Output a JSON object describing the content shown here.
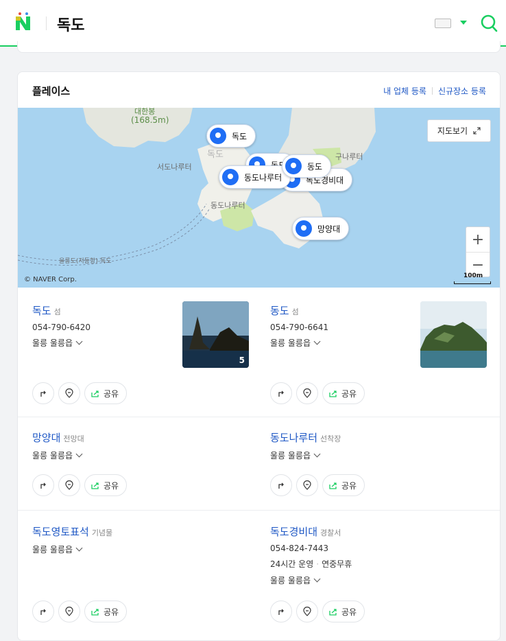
{
  "header": {
    "query": "독도",
    "icons": [
      "naver-logo-icon",
      "keyboard-icon",
      "caret-down-icon",
      "search-icon"
    ],
    "accent_color": "#19ce60"
  },
  "card": {
    "title": "플레이스",
    "links": [
      "내 업체 등록",
      "신규장소 등록"
    ],
    "link_color": "#1f58c5"
  },
  "map": {
    "view_button": "지도보기",
    "copyright": "© NAVER Corp.",
    "scale": "100m",
    "labels": [
      "대한봉",
      "(168.5m)",
      "독도",
      "서도나루터",
      "동도나루터",
      "구나루터",
      "울릉도(저동항)-독도"
    ],
    "pins": [
      "독도",
      "동도",
      "동도",
      "동도나루터",
      "독도경비대",
      "망양대"
    ]
  },
  "places": [
    {
      "name": "독도",
      "category": "섬",
      "phone": "054-790-6420",
      "address": "울릉 울릉읍",
      "photo_count": "5"
    },
    {
      "name": "동도",
      "category": "섬",
      "phone": "054-790-6641",
      "address": "울릉 울릉읍"
    },
    {
      "name": "망양대",
      "category": "전망대",
      "address": "울릉 울릉읍"
    },
    {
      "name": "동도나루터",
      "category": "선착장",
      "address": "울릉 울릉읍"
    },
    {
      "name": "독도영토표석",
      "category": "기념물",
      "address": "울릉 울릉읍"
    },
    {
      "name": "독도경비대",
      "category": "경찰서",
      "phone": "054-824-7443",
      "hours": "24시간 운영",
      "holiday": "연중무휴",
      "address": "울릉 울릉읍"
    }
  ],
  "actions": {
    "share": "공유"
  }
}
